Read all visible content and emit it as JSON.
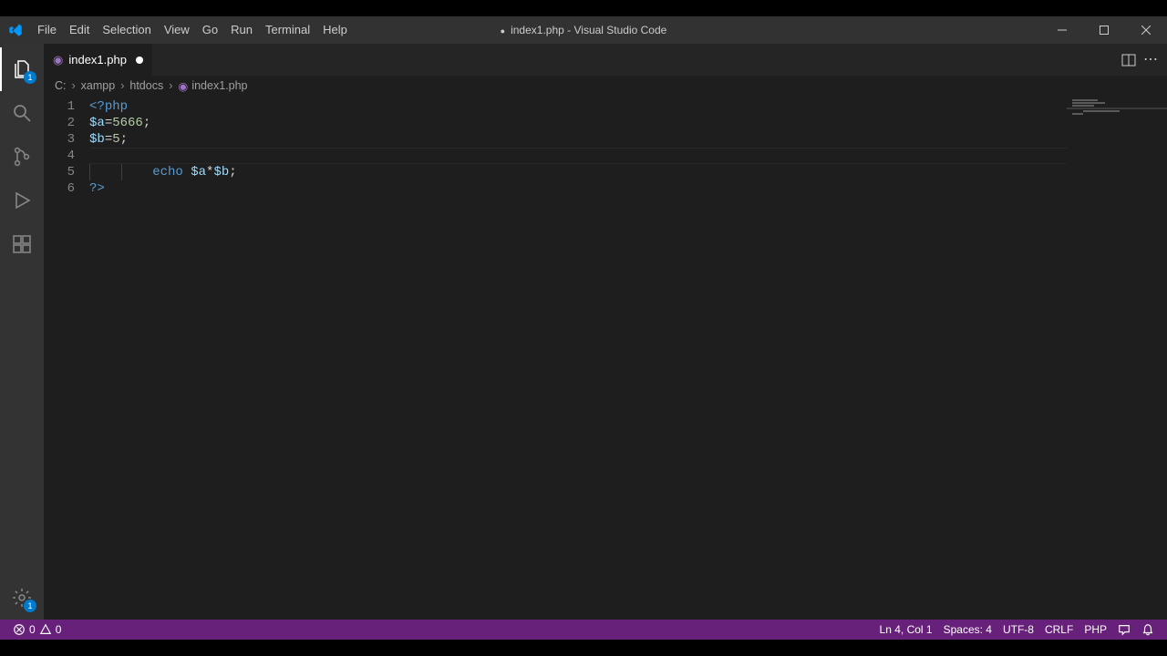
{
  "window": {
    "title_file": "index1.php",
    "title_app": "Visual Studio Code",
    "modified": true
  },
  "menu": {
    "items": [
      "File",
      "Edit",
      "Selection",
      "View",
      "Go",
      "Run",
      "Terminal",
      "Help"
    ]
  },
  "activity": {
    "items": [
      {
        "name": "explorer",
        "icon": "files-icon",
        "active": true,
        "badge": "1"
      },
      {
        "name": "search",
        "icon": "search-icon",
        "active": false
      },
      {
        "name": "scm",
        "icon": "source-control-icon",
        "active": false
      },
      {
        "name": "run-debug",
        "icon": "debug-icon",
        "active": false
      },
      {
        "name": "extensions",
        "icon": "extensions-icon",
        "active": false
      }
    ],
    "bottom": [
      {
        "name": "manage",
        "icon": "gear-icon",
        "badge": "1"
      }
    ]
  },
  "tabs": {
    "open": [
      {
        "label": "index1.php",
        "modified": true,
        "icon": "php-file-icon"
      }
    ]
  },
  "breadcrumb": {
    "segments": [
      "C:",
      "xampp",
      "htdocs"
    ],
    "file": "index1.php"
  },
  "editor": {
    "lines": [
      {
        "n": 1,
        "tokens": [
          {
            "t": "<?",
            "c": "tok-tag"
          },
          {
            "t": "php",
            "c": "tok-tag"
          }
        ]
      },
      {
        "n": 2,
        "tokens": [
          {
            "t": "$a",
            "c": "tok-var"
          },
          {
            "t": "=",
            "c": "tok-op"
          },
          {
            "t": "5666",
            "c": "tok-num"
          },
          {
            "t": ";",
            "c": "tok-punc"
          }
        ]
      },
      {
        "n": 3,
        "tokens": [
          {
            "t": "$b",
            "c": "tok-var"
          },
          {
            "t": "=",
            "c": "tok-op"
          },
          {
            "t": "5",
            "c": "tok-num"
          },
          {
            "t": ";",
            "c": "tok-punc"
          }
        ]
      },
      {
        "n": 4,
        "tokens": [],
        "current": true
      },
      {
        "n": 5,
        "indent": 2,
        "tokens": [
          {
            "t": "echo",
            "c": "tok-kw"
          },
          {
            "t": " ",
            "c": ""
          },
          {
            "t": "$a",
            "c": "tok-var"
          },
          {
            "t": "*",
            "c": "tok-op"
          },
          {
            "t": "$b",
            "c": "tok-var"
          },
          {
            "t": ";",
            "c": "tok-punc"
          }
        ]
      },
      {
        "n": 6,
        "tokens": [
          {
            "t": "?>",
            "c": "tok-tag"
          }
        ]
      }
    ]
  },
  "statusbar": {
    "errors": "0",
    "warnings": "0",
    "cursor": "Ln 4, Col 1",
    "spaces": "Spaces: 4",
    "encoding": "UTF-8",
    "eol": "CRLF",
    "language": "PHP"
  }
}
